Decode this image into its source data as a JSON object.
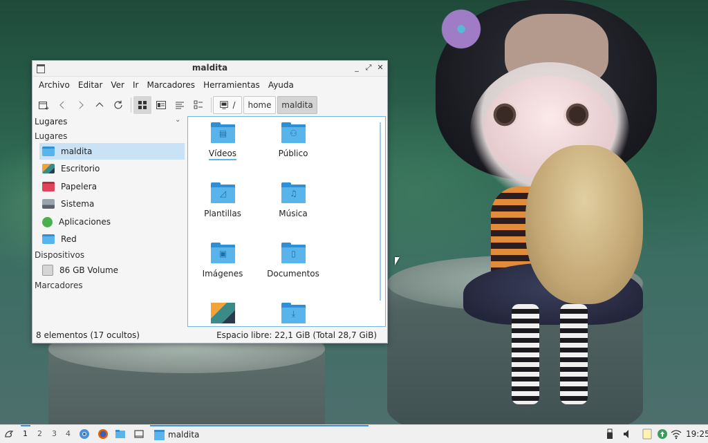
{
  "window": {
    "title": "maldita",
    "menu": [
      "Archivo",
      "Editar",
      "Ver",
      "Ir",
      "Marcadores",
      "Herramientas",
      "Ayuda"
    ],
    "path": {
      "root_sep": "/",
      "segments": [
        "home",
        "maldita"
      ]
    },
    "sidebar": {
      "dropdown_label": "Lugares",
      "section_places": "Lugares",
      "places": [
        "maldita",
        "Escritorio",
        "Papelera",
        "Sistema",
        "Aplicaciones",
        "Red"
      ],
      "section_devices": "Dispositivos",
      "devices": [
        "86 GB Volume"
      ],
      "section_bookmarks": "Marcadores"
    },
    "files": [
      "Vídeos",
      "Público",
      "Plantillas",
      "Música",
      "Imágenes",
      "Documentos",
      "",
      ""
    ],
    "status": {
      "count": "8 elementos (17 ocultos)",
      "free": "Espacio libre: 22,1 GiB (Total 28,7 GiB)"
    }
  },
  "taskbar": {
    "workspaces": [
      "1",
      "2",
      "3",
      "4"
    ],
    "task_title": "maldita",
    "clock": "19:25"
  },
  "colors": {
    "accent": "#3d8fe0",
    "folder": "#5ab4ec",
    "selection": "#c9e2f6"
  }
}
